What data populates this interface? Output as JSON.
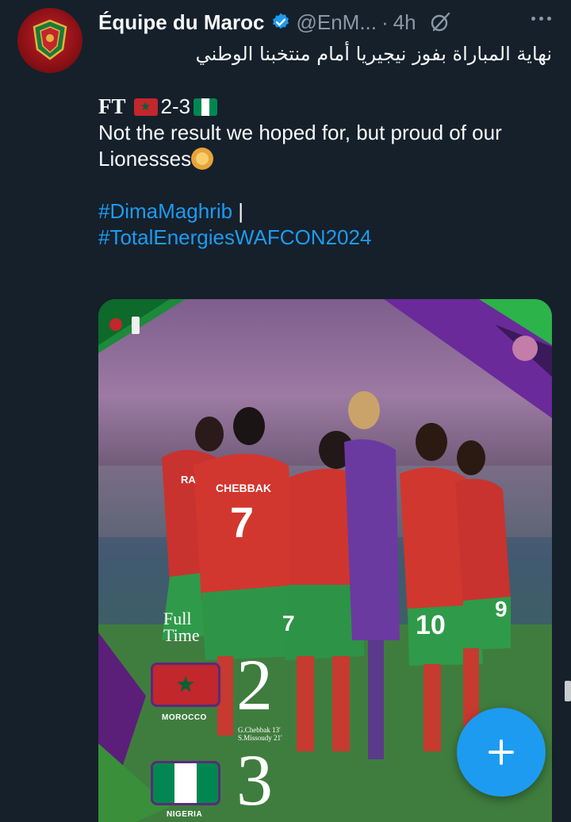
{
  "account": {
    "name": "Équipe du Maroc",
    "handle": "@EnM...",
    "separator": "·",
    "time": "4h",
    "verified": true
  },
  "icons": [
    "verified-badge-icon",
    "grok-icon",
    "more-icon",
    "plus-icon"
  ],
  "tweet": {
    "arabic_line": "نهاية المباراة بفوز نيجيريا أمام منتخبنا الوطني",
    "ft_label": "FT",
    "score": "2-3",
    "message": "Not the result we hoped for, but proud of our Lionesses",
    "hashtag1": "#DimaMaghrib",
    "hashtag_separator": " |",
    "hashtag2": "#TotalEnergiesWAFCON2024"
  },
  "media": {
    "full_time_line1": "Full",
    "full_time_line2": "Time",
    "team1": "MOROCCO",
    "team1_score": "2",
    "team2": "NIGERIA",
    "team2_score": "3",
    "scorer1": "G.Chebbak  13'",
    "scorer2": "S.Missoudy  21'",
    "shirt_names": [
      "RA",
      "CHEBBAK"
    ],
    "shirt_numbers": [
      "7",
      "10",
      "9",
      "7"
    ]
  },
  "colors": {
    "background": "#15202b",
    "accent": "#1d9bf0",
    "secondary_text": "#8b98a5",
    "morocco_red": "#c1272d",
    "morocco_green": "#006233",
    "nigeria_green": "#008751"
  }
}
